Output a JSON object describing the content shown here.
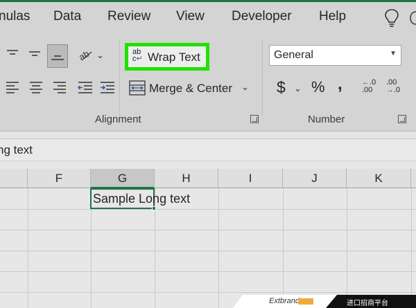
{
  "tabs": [
    "nulas",
    "Data",
    "Review",
    "View",
    "Developer",
    "Help"
  ],
  "ribbon": {
    "wrap_text": {
      "label": "Wrap Text",
      "glyph_top": "ab",
      "glyph_bottom": "c"
    },
    "merge_center": {
      "label": "Merge & Center"
    },
    "alignment_group": "Alignment",
    "number_group": "Number",
    "number_format": "General",
    "currency_symbol": "$",
    "percent_symbol": "%",
    "comma_symbol": ","
  },
  "formula_bar": {
    "text": "ng text"
  },
  "columns": [
    "F",
    "G",
    "H",
    "I",
    "J",
    "K"
  ],
  "selected_column": "G",
  "cell": {
    "text": "Sample Long text"
  },
  "watermark": {
    "brand": "Extbrand",
    "cn": "进口招商平台"
  },
  "colors": {
    "excel_green": "#217346",
    "highlight": "#22e000"
  }
}
